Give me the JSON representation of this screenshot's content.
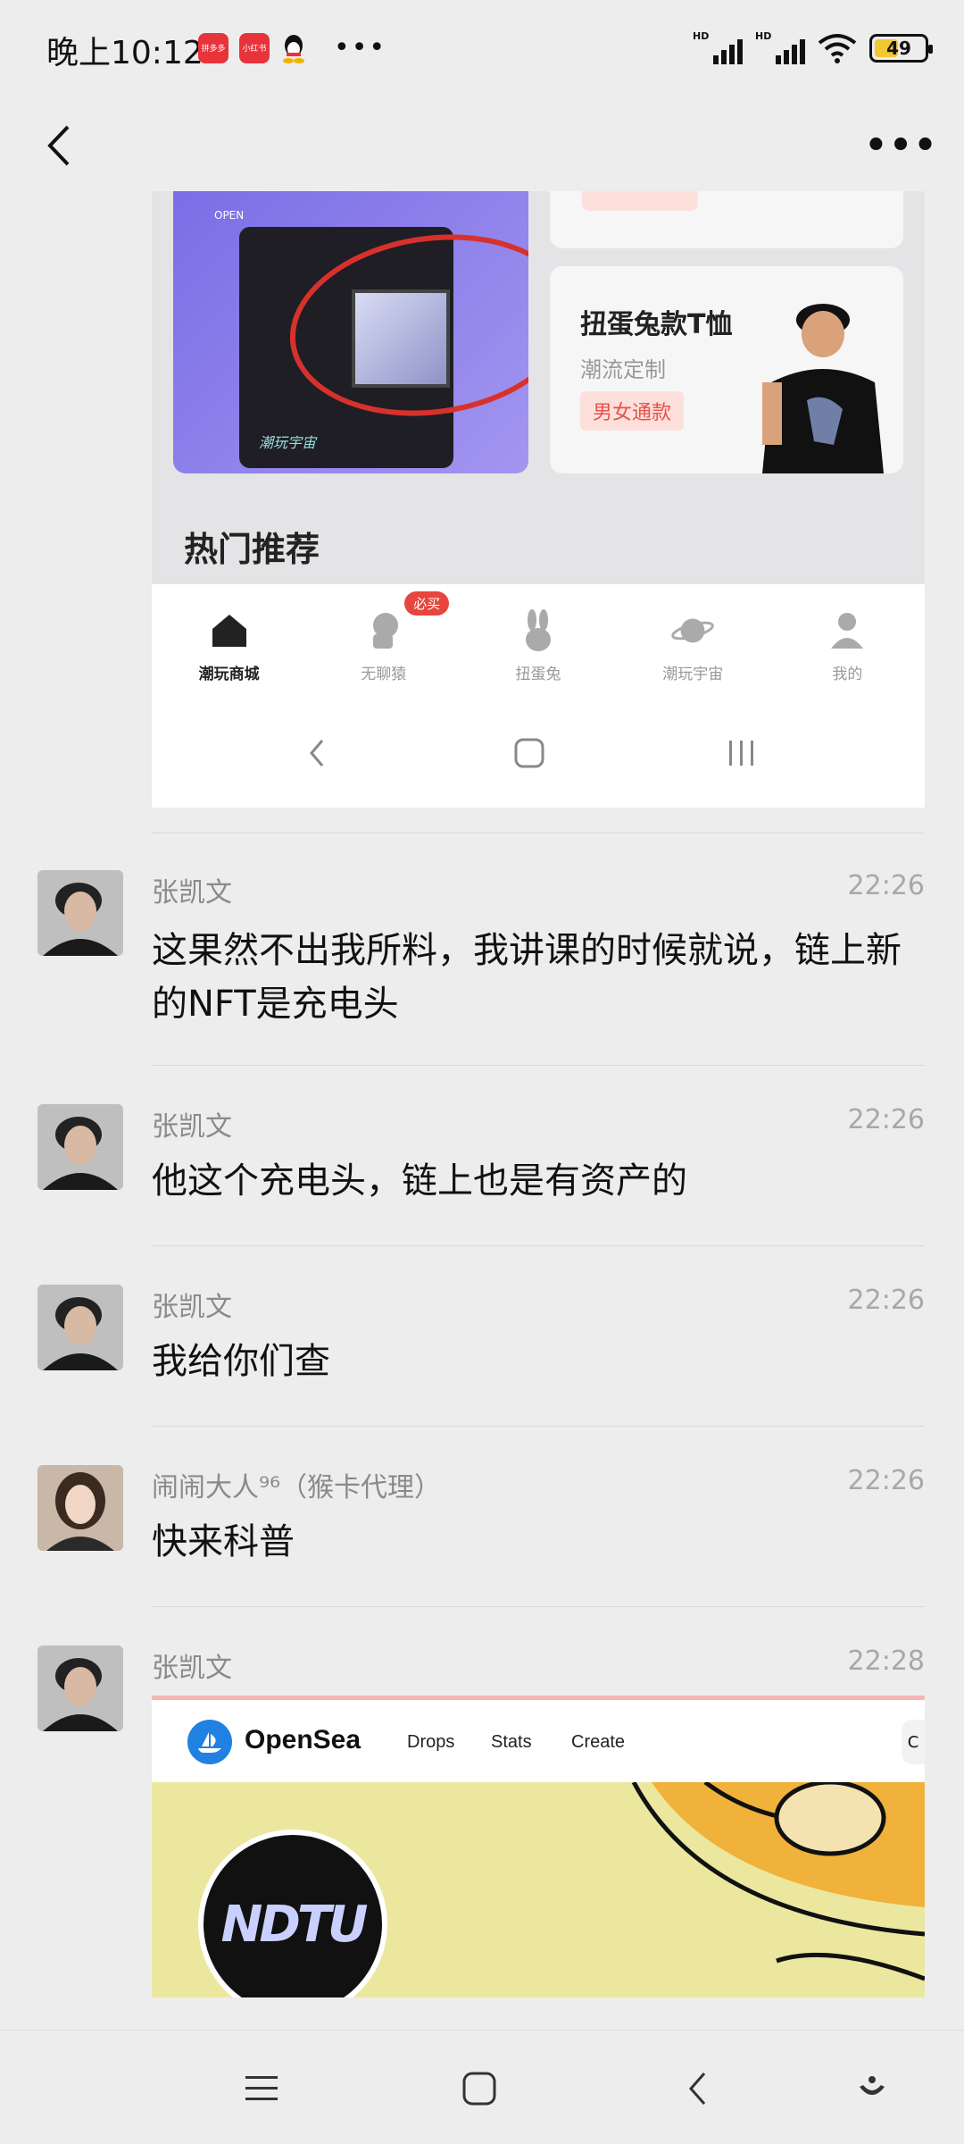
{
  "status_bar": {
    "time": "晚上10:12",
    "apps": [
      "拼多多",
      "小红书"
    ],
    "battery_level": "49",
    "battery_fraction": 0.49
  },
  "nav": {
    "back_icon": "chevron-left-icon",
    "more_icon": "more-dots-icon"
  },
  "embedded_screenshot": {
    "promo_title": "扭蛋兔款T恤",
    "promo_subtitle": "潮流定制",
    "promo_tag": "男女通款",
    "pack_brand": "潮玩宇宙",
    "pack_open_label": "OPEN",
    "section_title": "热门推荐",
    "tabs": [
      {
        "label": "潮玩商城",
        "icon": "home-icon",
        "active": true
      },
      {
        "label": "无聊猿",
        "icon": "ape-icon",
        "active": false,
        "badge": "必买"
      },
      {
        "label": "扭蛋兔",
        "icon": "rabbit-icon",
        "active": false
      },
      {
        "label": "潮玩宇宙",
        "icon": "planet-icon",
        "active": false
      },
      {
        "label": "我的",
        "icon": "user-icon",
        "active": false
      }
    ]
  },
  "messages": [
    {
      "sender": "张凯文",
      "time": "22:26",
      "text": "这果然不出我所料，我讲课的时候就说，链上新的NFT是充电头"
    },
    {
      "sender": "张凯文",
      "time": "22:26",
      "text": "他这个充电头，链上也是有资产的"
    },
    {
      "sender": "张凯文",
      "time": "22:26",
      "text": "我给你们查"
    },
    {
      "sender": "闹闹大人⁹⁶（猴卡代理）",
      "time": "22:26",
      "text": "快来科普"
    },
    {
      "sender": "张凯文",
      "time": "22:28",
      "text": ""
    }
  ],
  "opensea_card": {
    "brand": "OpenSea",
    "nav": [
      "Drops",
      "Stats",
      "Create"
    ],
    "edge_letter": "C",
    "avatar_text": "NDTU"
  },
  "bottom_bar": {
    "icons": [
      "menu-icon",
      "home-square-icon",
      "back-icon",
      "assistant-icon"
    ]
  }
}
